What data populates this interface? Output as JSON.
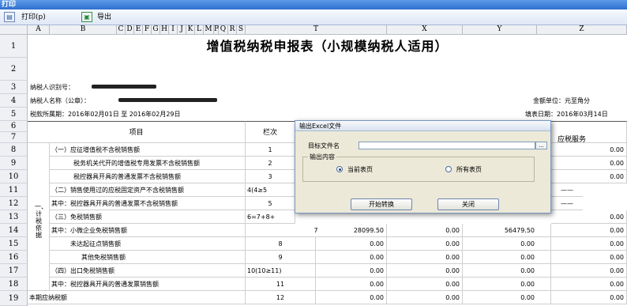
{
  "window": {
    "title": "打印"
  },
  "toolbar": {
    "print_label": "打印(p)",
    "export_label": "导出"
  },
  "columns": [
    "A",
    "B",
    "C",
    "D",
    "E",
    "F",
    "G",
    "H",
    "I",
    "J",
    "K",
    "L",
    "M",
    "P",
    "Q",
    "R",
    "S",
    "T",
    "X",
    "Y",
    "Z"
  ],
  "rows": [
    "1",
    "2",
    "3",
    "4",
    "5",
    "6",
    "7",
    "8",
    "9",
    "10",
    "11",
    "12",
    "13",
    "14",
    "15",
    "16",
    "17",
    "18",
    "19"
  ],
  "report": {
    "title": "增值税纳税申报表（小规模纳税人适用）",
    "taxpayer_id_label": "纳税人识别号：",
    "taxpayer_name_label": "纳税人名称（公章）：",
    "amount_unit": "金额单位：元至角分",
    "period": "税款所属期：2016年02月01日 至 2016年02月29日",
    "fill_date": "填表日期：2016年03月14日",
    "header_item": "项目",
    "header_lineno": "栏次",
    "header_service": "应税服务",
    "section_label": "一、计税依据",
    "lines": [
      {
        "item": "（一）应征增值税不含税销售额",
        "no": "1",
        "col_t": "",
        "col_x": "",
        "col_y": "",
        "col_z": "0.00"
      },
      {
        "item": "税务机关代开的增值税专用发票不含税销售额",
        "no": "2",
        "col_t": "",
        "col_x": "",
        "col_y": "",
        "col_z": "0.00"
      },
      {
        "item": "税控器具开具的普通发票不含税销售额",
        "no": "3",
        "col_t": "",
        "col_x": "",
        "col_y": "",
        "col_z": "0.00"
      },
      {
        "item": "（二）销售使用过的应税固定资产不含税销售额",
        "no": "4(4≥5",
        "col_t": "",
        "col_x": "",
        "col_y": "",
        "col_z": "——"
      },
      {
        "item": "其中：税控器具开具的普通发票不含税销售额",
        "no": "5",
        "col_t": "",
        "col_x": "",
        "col_y": "",
        "col_z": "——"
      },
      {
        "item": "（三）免税销售额",
        "no": "6=7+8+",
        "col_t": "",
        "col_x": "",
        "col_y": "",
        "col_z": "0.00"
      },
      {
        "item": "其中：小微企业免税销售额",
        "no": "7",
        "col_t": "28099.50",
        "col_x": "0.00",
        "col_y": "56479.50",
        "col_z": "0.00"
      },
      {
        "item": "未达起征点销售额",
        "no": "8",
        "col_t": "0.00",
        "col_x": "0.00",
        "col_y": "0.00",
        "col_z": "0.00"
      },
      {
        "item": "其他免税销售额",
        "no": "9",
        "col_t": "0.00",
        "col_x": "0.00",
        "col_y": "0.00",
        "col_z": "0.00"
      },
      {
        "item": "（四）出口免税销售额",
        "no": "10(10≥11)",
        "col_t": "0.00",
        "col_x": "0.00",
        "col_y": "0.00",
        "col_z": "0.00"
      },
      {
        "item": "其中：税控器具开具的普通发票销售额",
        "no": "11",
        "col_t": "0.00",
        "col_x": "0.00",
        "col_y": "0.00",
        "col_z": "0.00"
      },
      {
        "item": "本期应纳税额",
        "no": "12",
        "col_t": "0.00",
        "col_x": "0.00",
        "col_y": "0.00",
        "col_z": "0.00"
      }
    ]
  },
  "dialog": {
    "title": "输出Excel文件",
    "filename_label": "目标文件名",
    "filename_value": "",
    "browse_label": "...",
    "content_label": "输出内容",
    "option_current": "当前表页",
    "option_all": "所有表页",
    "selected_option": "当前表页",
    "start_button": "开始转换",
    "close_button": "关闭"
  }
}
